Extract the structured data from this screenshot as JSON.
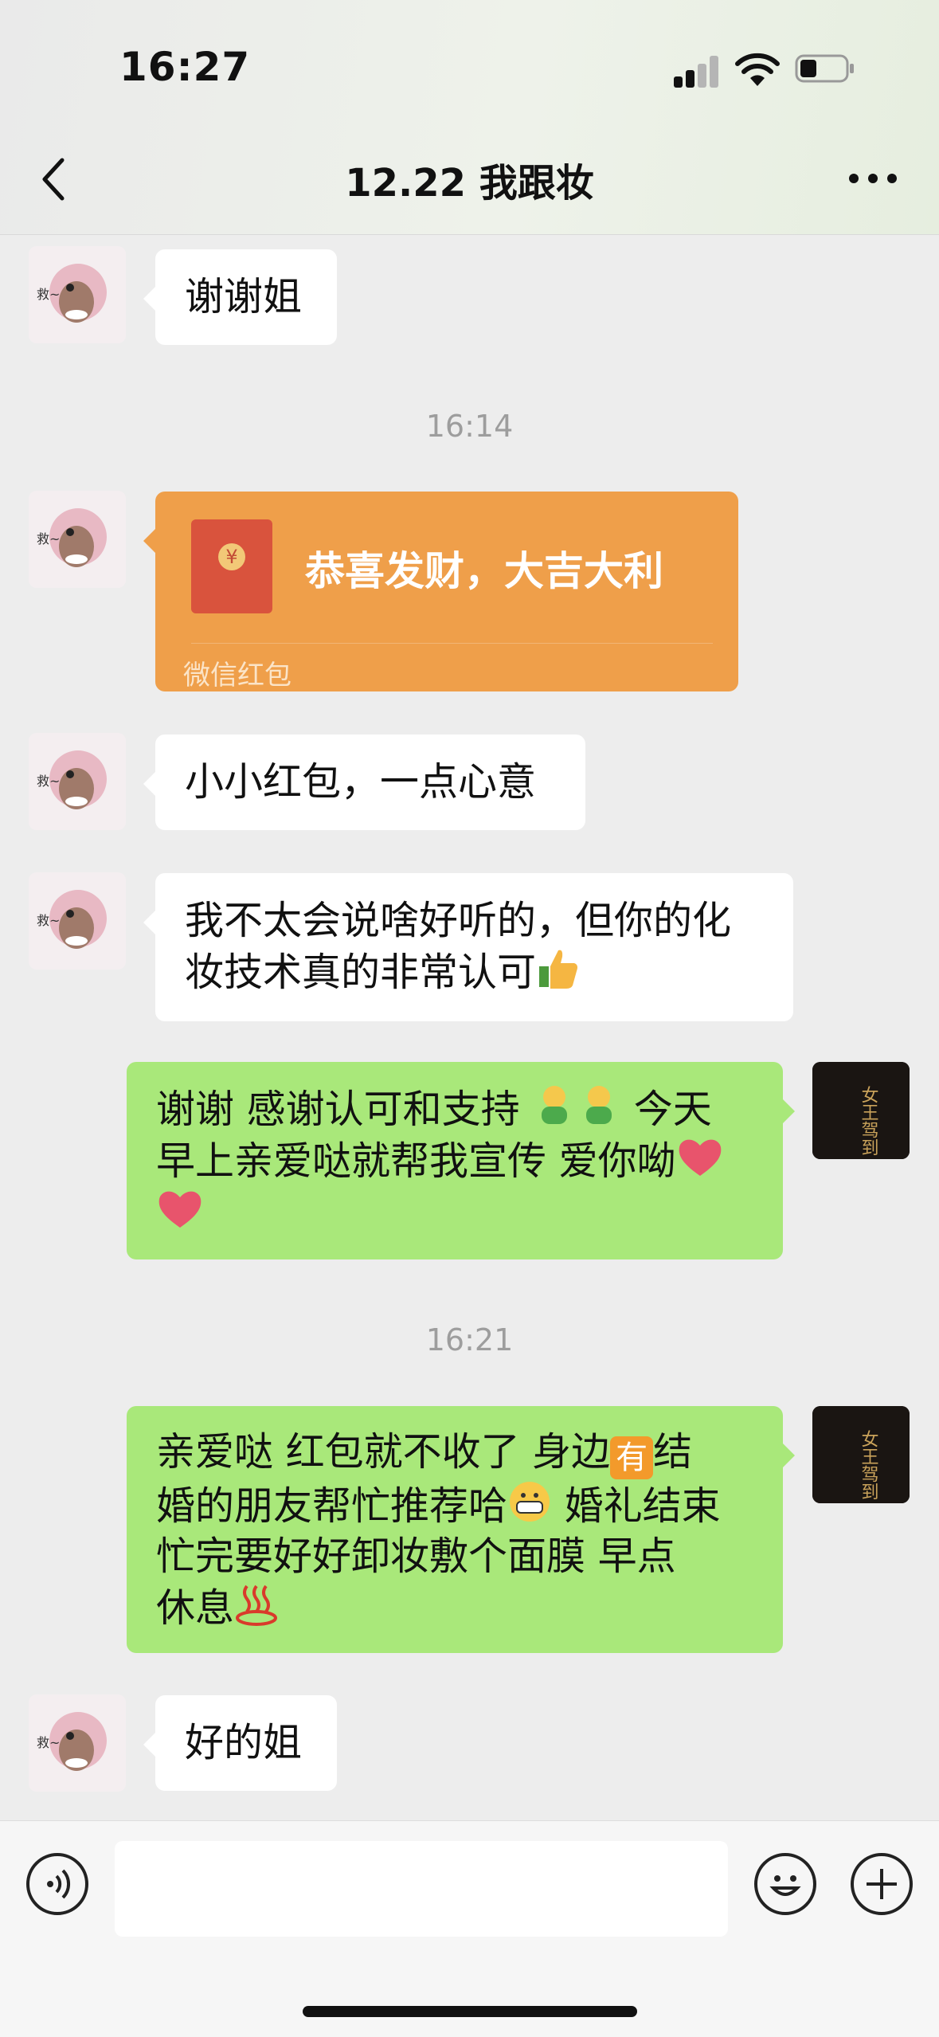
{
  "status_bar": {
    "time": "16:27"
  },
  "header": {
    "title": "12.22 我跟妆"
  },
  "messages": [
    {
      "side": "left",
      "text": "谢谢姐"
    },
    {
      "timestamp": "16:14"
    },
    {
      "side": "left",
      "type": "red_packet",
      "wish": "恭喜发财，大吉大利",
      "label": "微信红包",
      "coin": "¥"
    },
    {
      "side": "left",
      "text": "小小红包，一点心意"
    },
    {
      "side": "left",
      "lines": [
        "我不太会说啥好听的，但你的化",
        "妆技术真的非常认可"
      ]
    },
    {
      "side": "right",
      "lines": [
        "谢谢 感谢认可和支持",
        "今天",
        "早上亲爱哒就帮我宣传 爱你呦"
      ]
    },
    {
      "timestamp": "16:21"
    },
    {
      "side": "right",
      "lines": [
        "亲爱哒 红包就不收了 身边",
        "结",
        "婚的朋友帮忙推荐哈",
        "婚礼结束",
        "忙完要好好卸妆敷个面膜  早点",
        "休息"
      ],
      "badge": "有"
    },
    {
      "side": "left",
      "text": "好的姐"
    }
  ],
  "input_bar": {
    "placeholder": ""
  },
  "colors": {
    "outgoing_bubble": "#a9e87a",
    "incoming_bubble": "#ffffff",
    "red_packet": "#ef9f4a",
    "background": "#ededed"
  },
  "icons": [
    "signal-icon",
    "wifi-icon",
    "battery-icon",
    "back-icon",
    "more-icon",
    "thumbs-up-icon",
    "smiley-person-icon",
    "heart-icon",
    "grin-icon",
    "hot-springs-icon",
    "voice-icon",
    "emoji-icon",
    "plus-icon"
  ]
}
